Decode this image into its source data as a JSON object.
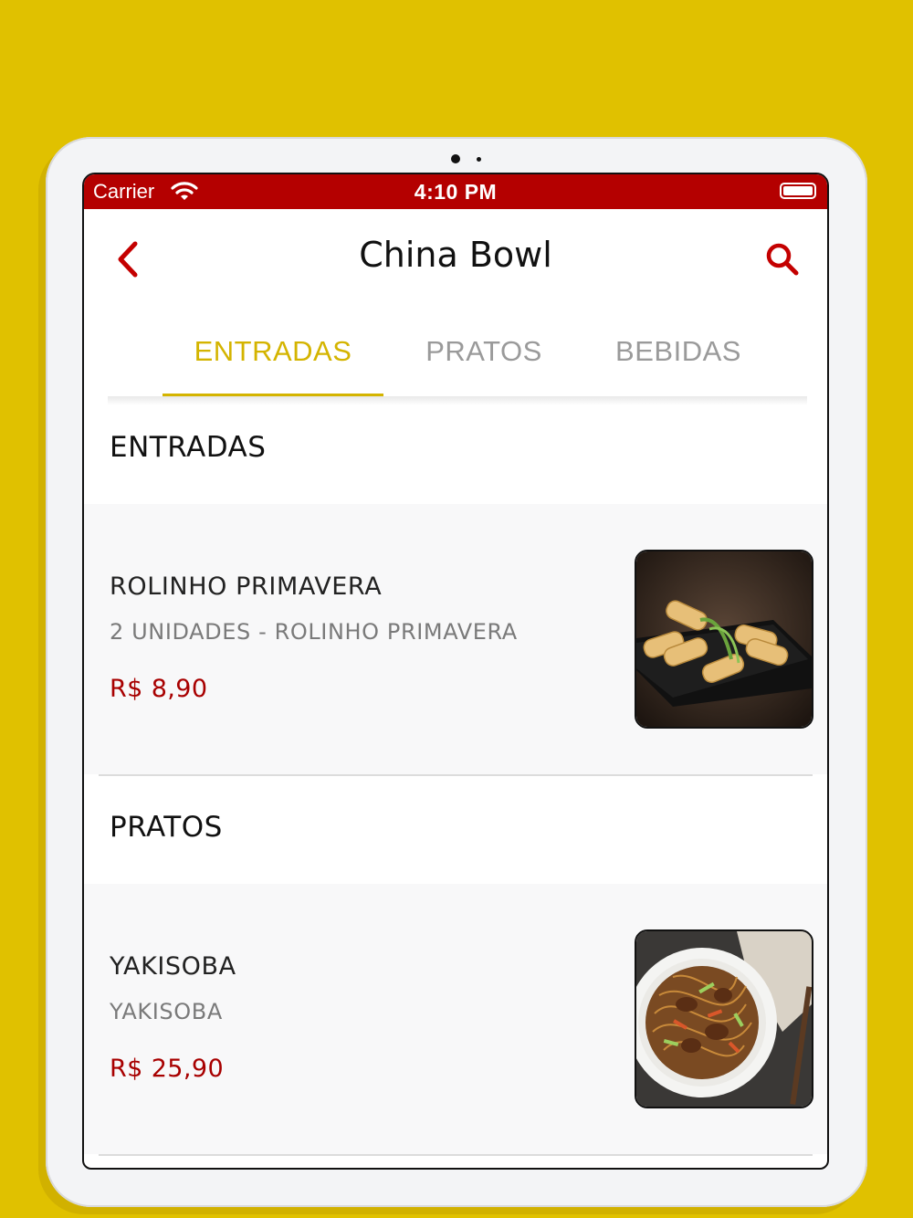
{
  "statusbar": {
    "carrier": "Carrier",
    "time": "4:10 PM"
  },
  "navbar": {
    "title": "China Bowl",
    "back_icon": "chevron-left-icon",
    "search_icon": "search-icon"
  },
  "tabs": [
    {
      "label": "ENTRADAS",
      "active": true
    },
    {
      "label": "PRATOS",
      "active": false
    },
    {
      "label": "BEBIDAS",
      "active": false
    }
  ],
  "sections": [
    {
      "title": "ENTRADAS",
      "items": [
        {
          "name": "ROLINHO PRIMAVERA",
          "description": "2 UNIDADES - ROLINHO PRIMAVERA",
          "price": "R$ 8,90",
          "image": "spring-rolls-photo"
        }
      ]
    },
    {
      "title": "PRATOS",
      "items": [
        {
          "name": "YAKISOBA",
          "description": "YAKISOBA",
          "price": "R$ 25,90",
          "image": "yakisoba-photo"
        }
      ]
    }
  ],
  "colors": {
    "background": "#e0c100",
    "statusbar": "#b40000",
    "accent": "#d4b400",
    "price": "#a80000"
  }
}
